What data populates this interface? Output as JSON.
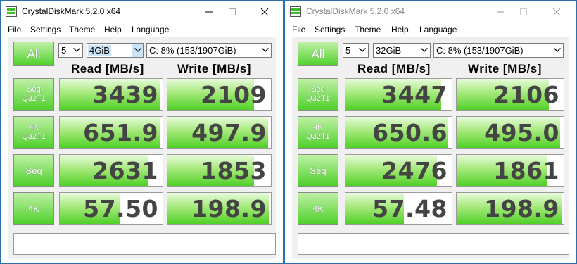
{
  "windows": [
    {
      "title": "CrystalDiskMark 5.2.0 x64",
      "menu": [
        "File",
        "Settings",
        "Theme",
        "Help",
        "Language"
      ],
      "all_label": "All",
      "count_value": "5",
      "size_value": "4GiB",
      "drive_value": "C: 8% (153/1907GiB)",
      "read_header": "Read [MB/s]",
      "write_header": "Write [MB/s]",
      "rows": [
        {
          "label_line1": "Seq",
          "label_line2": "Q32T1",
          "read": "3439",
          "write": "2109",
          "read_fill": 0.97,
          "write_fill": 0.84
        },
        {
          "label_line1": "4K",
          "label_line2": "Q32T1",
          "read": "651.9",
          "write": "497.9",
          "read_fill": 0.97,
          "write_fill": 0.97
        },
        {
          "label_line1": "Seq",
          "label_line2": "",
          "read": "2631",
          "write": "1853",
          "read_fill": 0.86,
          "write_fill": 0.84
        },
        {
          "label_line1": "4K",
          "label_line2": "",
          "read": "57.50",
          "write": "198.9",
          "read_fill": 0.58,
          "write_fill": 0.98
        }
      ],
      "comment": ""
    },
    {
      "title": "CrystalDiskMark 5.2.0 x64",
      "menu": [
        "File",
        "Settings",
        "Theme",
        "Help",
        "Language"
      ],
      "all_label": "All",
      "count_value": "5",
      "size_value": "32GiB",
      "drive_value": "C: 8% (153/1907GiB)",
      "read_header": "Read [MB/s]",
      "write_header": "Write [MB/s]",
      "rows": [
        {
          "label_line1": "Seq",
          "label_line2": "Q32T1",
          "read": "3447",
          "write": "2106",
          "read_fill": 0.9,
          "write_fill": 0.86
        },
        {
          "label_line1": "4K",
          "label_line2": "Q32T1",
          "read": "650.6",
          "write": "495.0",
          "read_fill": 0.96,
          "write_fill": 0.97
        },
        {
          "label_line1": "Seq",
          "label_line2": "",
          "read": "2476",
          "write": "1861",
          "read_fill": 0.86,
          "write_fill": 0.84
        },
        {
          "label_line1": "4K",
          "label_line2": "",
          "read": "57.48",
          "write": "198.9",
          "read_fill": 0.55,
          "write_fill": 0.98
        }
      ],
      "comment": ""
    }
  ]
}
